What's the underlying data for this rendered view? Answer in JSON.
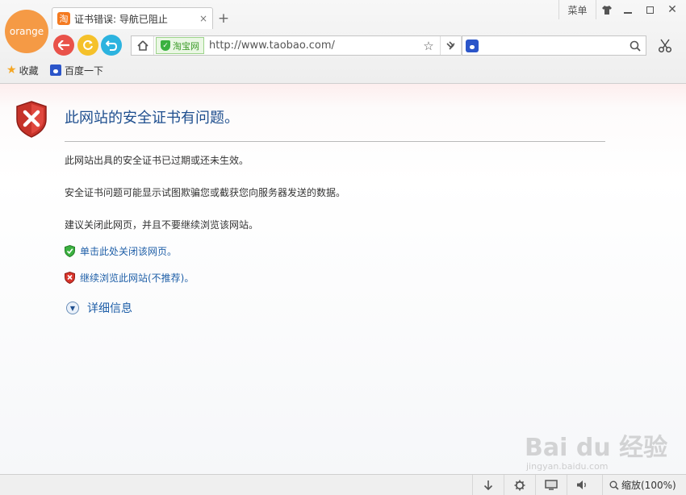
{
  "brand": {
    "label": "orange"
  },
  "tab": {
    "favicon_char": "淘",
    "title": "证书错误: 导航已阻止",
    "close": "×",
    "new_tab": "+"
  },
  "window": {
    "menu_label": "菜单",
    "close": "✕"
  },
  "address": {
    "site_badge": "淘宝网",
    "url": "http://www.taobao.com/"
  },
  "search": {
    "value": "",
    "placeholder": ""
  },
  "bookmarks": [
    {
      "label": "收藏",
      "icon": "star-icon"
    },
    {
      "label": "百度一下",
      "icon": "baidu-paw-icon"
    }
  ],
  "page": {
    "heading": "此网站的安全证书有问题。",
    "paragraphs": [
      "此网站出具的安全证书已过期或还未生效。",
      "安全证书问题可能显示试图欺骗您或截获您向服务器发送的数据。",
      "建议关闭此网页，并且不要继续浏览该网站。"
    ],
    "close_link": "单击此处关闭该网页。",
    "continue_link": "继续浏览此网站(不推荐)。",
    "details": "详细信息"
  },
  "watermark": {
    "main": "Bai du 经验",
    "sub": "jingyan.baidu.com"
  },
  "status": {
    "zoom": "缩放(100%)"
  },
  "colors": {
    "link": "#1f5fa8",
    "heading": "#1f4f8f",
    "safe_green": "#3bb140",
    "danger_red": "#d9342b",
    "brand": "#f59a45"
  }
}
